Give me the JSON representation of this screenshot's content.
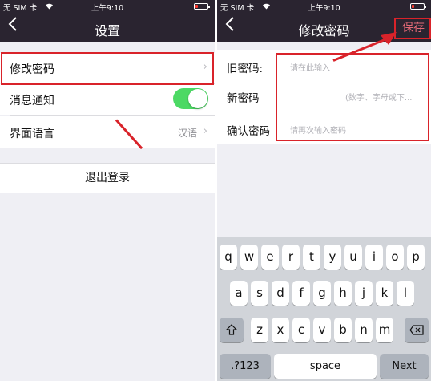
{
  "status": {
    "carrier": "无 SIM 卡",
    "time": "上午9:10"
  },
  "colors": {
    "bar": "#2a2430",
    "accent": "#e46a77",
    "toggle_on": "#4cd964",
    "annotation": "#d9232a"
  },
  "settings_screen": {
    "back_icon": "chevron-left-icon",
    "title": "设置",
    "rows": [
      {
        "label": "修改密码"
      },
      {
        "label": "消息通知",
        "toggle_on": true
      },
      {
        "label": "界面语言",
        "value": "汉语"
      }
    ],
    "logout": "退出登录"
  },
  "password_screen": {
    "back_icon": "chevron-left-icon",
    "title": "修改密码",
    "save": "保存",
    "fields": [
      {
        "label": "旧密码:",
        "placeholder": "请在此输入"
      },
      {
        "label": "新密码",
        "placeholder": "(数字、字母或下..."
      },
      {
        "label": "确认密码",
        "placeholder": "请再次输入密码"
      }
    ]
  },
  "keyboard": {
    "row1": [
      "q",
      "w",
      "e",
      "r",
      "t",
      "y",
      "u",
      "i",
      "o",
      "p"
    ],
    "row2": [
      "a",
      "s",
      "d",
      "f",
      "g",
      "h",
      "j",
      "k",
      "l"
    ],
    "row3": [
      "z",
      "x",
      "c",
      "v",
      "b",
      "n",
      "m"
    ],
    "shift_icon": "shift-icon",
    "delete_icon": "backspace-icon",
    "mode": ".?123",
    "space": "space",
    "next": "Next"
  }
}
